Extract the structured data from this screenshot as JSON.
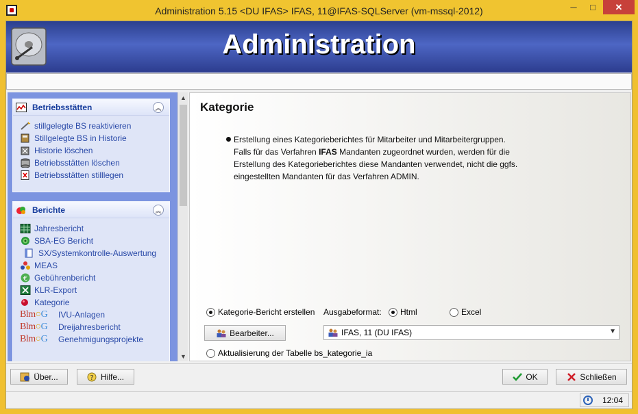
{
  "window": {
    "title": "Administration 5.15  <DU IFAS> IFAS, 11@IFAS-SQLServer (vm-mssql-2012)",
    "minimize": "─",
    "maximize": "□",
    "close": "✕"
  },
  "banner": {
    "title": "Administration"
  },
  "sidebar": {
    "panels": [
      {
        "title": "Betriebsstätten",
        "icon": "chart-icon",
        "items": [
          {
            "label": "stillgelegte BS reaktivieren",
            "icon": "wand-icon"
          },
          {
            "label": "Stillgelegte BS in Historie",
            "icon": "archive-icon"
          },
          {
            "label": "Historie löschen",
            "icon": "history-delete-icon"
          },
          {
            "label": "Betriebsstätten löschen",
            "icon": "database-icon"
          },
          {
            "label": "Betriebsstätten stilllegen",
            "icon": "document-x-icon"
          }
        ]
      },
      {
        "title": "Berichte",
        "icon": "reports-icon",
        "items": [
          {
            "label": "Jahresbericht",
            "icon": "grid-icon"
          },
          {
            "label": "SBA-EG Bericht",
            "icon": "target-icon"
          },
          {
            "label": "SX/Systemkontrolle-Auswertung",
            "icon": "book-icon"
          },
          {
            "label": "MEAS",
            "icon": "molecule-icon"
          },
          {
            "label": "Gebührenbericht",
            "icon": "euro-icon"
          },
          {
            "label": "KLR-Export",
            "icon": "excel-icon"
          },
          {
            "label": "Kategorie",
            "icon": "red-dot-icon"
          },
          {
            "label": "IVU-Anlagen",
            "icon": "blmg-logo"
          },
          {
            "label": "Dreijahresbericht",
            "icon": "blmg-logo"
          },
          {
            "label": "Genehmigungsprojekte",
            "icon": "blmg-logo"
          }
        ]
      }
    ],
    "blmg_logo": {
      "b": "Blm",
      "o": "○",
      "g": "G"
    }
  },
  "content": {
    "heading": "Kategorie",
    "description": {
      "line1": "Erstellung eines Kategorieberichtes für Mitarbeiter und Mitarbeitergruppen.",
      "line2_pre": "Falls für das Verfahren ",
      "line2_bold": "IFAS",
      "line2_post": " Mandanten zugeordnet wurden, werden für die",
      "line3": "Erstellung des Kategorieberichtes diese Mandanten verwendet, nicht die ggfs.",
      "line4": "eingestellten Mandanten für das Verfahren ADMIN."
    },
    "option_create": {
      "label": "Kategorie-Bericht erstellen",
      "checked": true
    },
    "output_format_label": "Ausgabeformat:",
    "format_html": {
      "label": "Html",
      "checked": true
    },
    "format_excel": {
      "label": "Excel",
      "checked": false
    },
    "editor_button": "Bearbeiter...",
    "editor_select": {
      "value": "IFAS, 11 (DU IFAS)"
    },
    "option_update": {
      "label": "Aktualisierung der Tabelle bs_kategorie_ia",
      "checked": false
    }
  },
  "footer": {
    "about_button": "Über...",
    "help_button": "Hilfe...",
    "ok_button": "OK",
    "close_button": "Schließen"
  },
  "status": {
    "time": "12:04"
  },
  "colors": {
    "window_frame": "#f0c430",
    "banner": "#3550a8",
    "sidebar": "#7c94e0",
    "link": "#2a4aa8"
  }
}
